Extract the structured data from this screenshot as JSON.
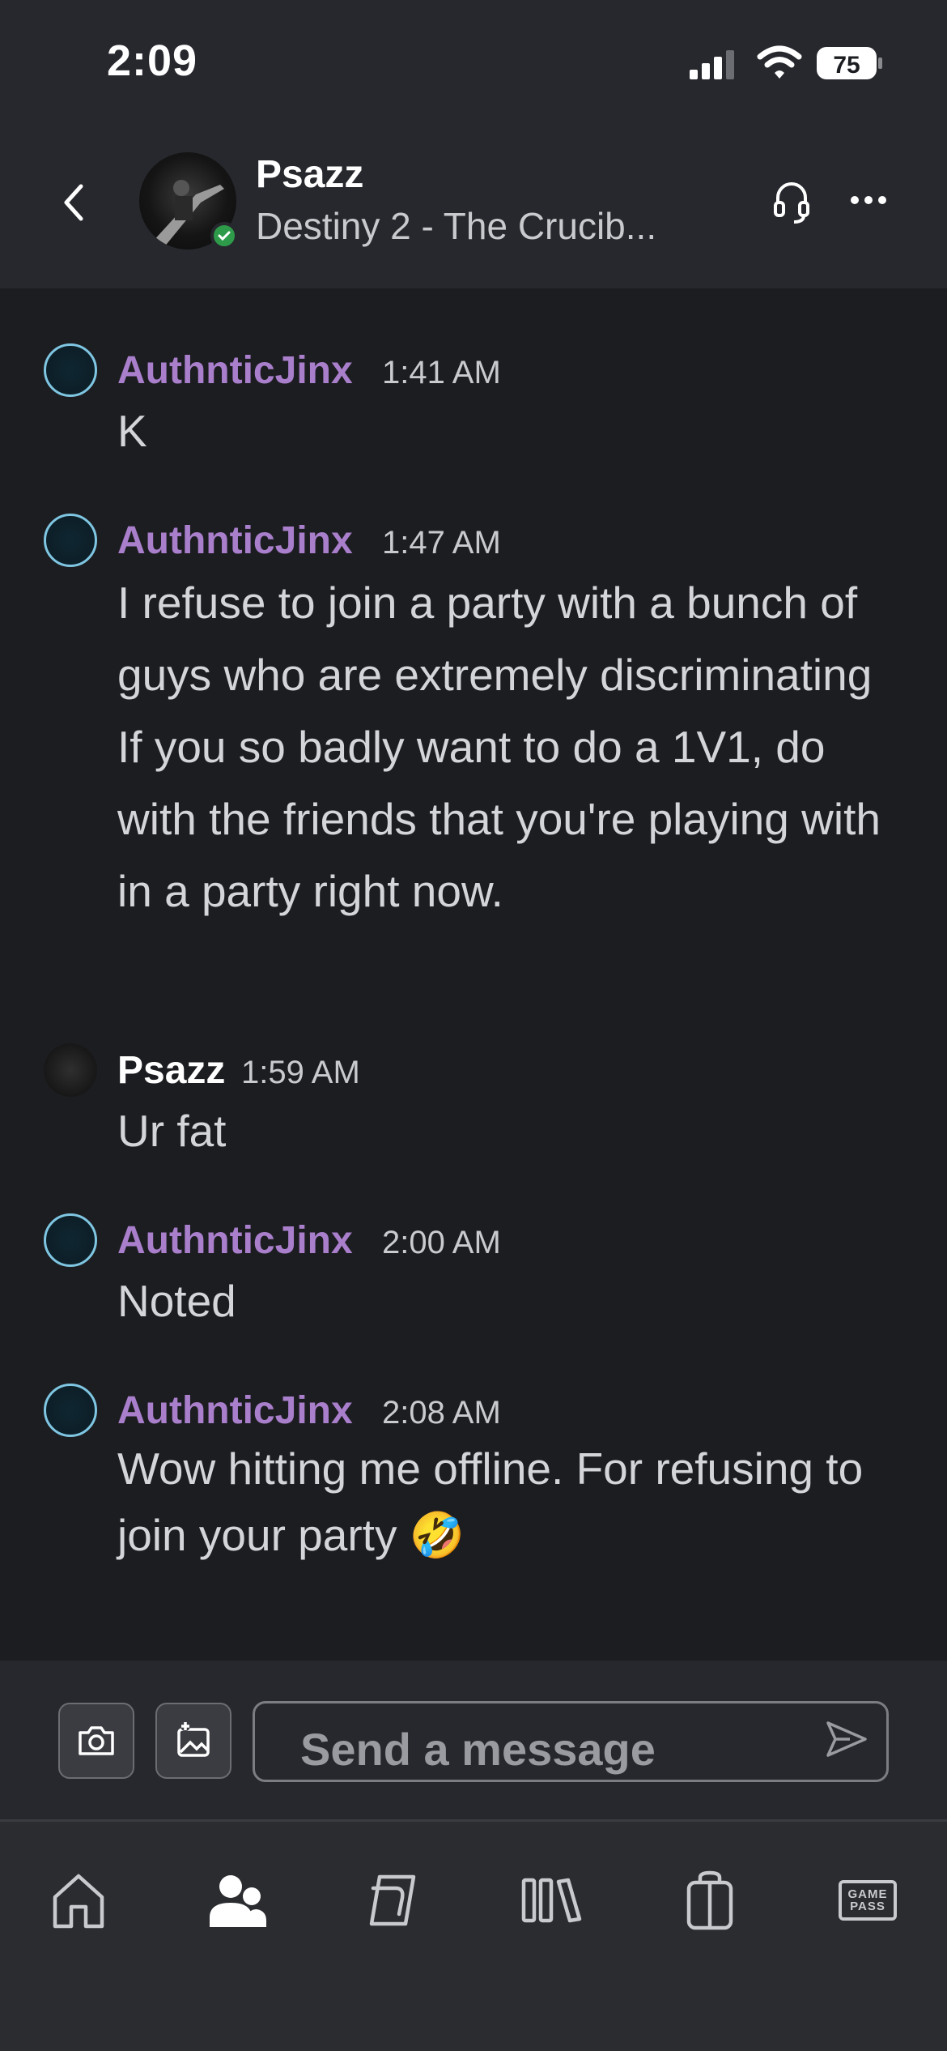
{
  "status_bar": {
    "time": "2:09",
    "battery_level": "75",
    "icons": [
      "signal-icon",
      "wifi-icon",
      "battery-icon"
    ]
  },
  "header": {
    "contact_name": "Psazz",
    "contact_status": "Destiny 2 - The Crucib...",
    "presence": "online",
    "icons": [
      "back-icon",
      "headset-icon",
      "more-icon"
    ]
  },
  "messages": [
    {
      "sender": "AuthnticJinx",
      "time": "1:41 AM",
      "text": "K"
    },
    {
      "sender": "AuthnticJinx",
      "time": "1:47 AM",
      "text": "I refuse to join a party with a bunch of guys who are extremely discriminating\nIf you so badly want to do a 1V1, do with the friends that you're playing with in a party right now."
    },
    {
      "sender": "Psazz",
      "time": "1:59 AM",
      "text": "Ur fat"
    },
    {
      "sender": "AuthnticJinx",
      "time": "2:00 AM",
      "text": "Noted"
    },
    {
      "sender": "AuthnticJinx",
      "time": "2:08 AM",
      "text": "Wow hitting me offline. For refusing to join your party 🤣"
    }
  ],
  "composer": {
    "placeholder": "Send a message",
    "value": "",
    "icons": [
      "camera-icon",
      "image-add-icon",
      "send-icon"
    ]
  },
  "tab_bar": {
    "tabs": [
      {
        "name": "home",
        "icon": "home-icon",
        "active": false
      },
      {
        "name": "social",
        "icon": "people-icon",
        "active": true
      },
      {
        "name": "store",
        "icon": "store-icon",
        "active": false
      },
      {
        "name": "library",
        "icon": "library-icon",
        "active": false
      },
      {
        "name": "gifts",
        "icon": "shopping-bag-icon",
        "active": false
      },
      {
        "name": "game-pass",
        "icon": "game-pass-icon",
        "active": false,
        "label_top": "GAME",
        "label_bottom": "PASS"
      }
    ]
  },
  "colors": {
    "background": "#1c1d21",
    "header_bg": "#26282d",
    "sender_accent": "#a97fcc",
    "online": "#2e9b4a",
    "text": "#d4d5d8"
  }
}
